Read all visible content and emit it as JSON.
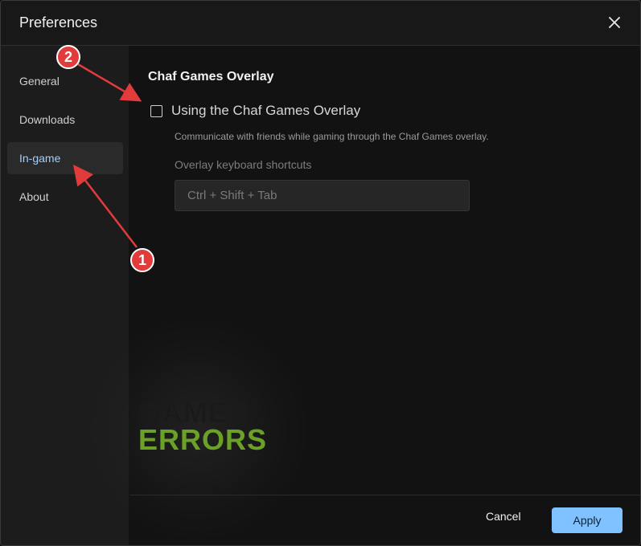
{
  "window": {
    "title": "Preferences"
  },
  "sidebar": {
    "items": [
      {
        "label": "General"
      },
      {
        "label": "Downloads"
      },
      {
        "label": "In-game"
      },
      {
        "label": "About"
      }
    ]
  },
  "main": {
    "section_title": "Chaf Games Overlay",
    "overlay_checkbox_label": "Using the Chaf Games Overlay",
    "overlay_checked": false,
    "description": "Communicate with friends while gaming through the Chaf Games overlay.",
    "shortcut_label": "Overlay keyboard shortcuts",
    "shortcut_value": "Ctrl + Shift + Tab"
  },
  "footer": {
    "cancel_label": "Cancel",
    "apply_label": "Apply"
  },
  "watermark": {
    "line1": "GAMES",
    "line2": "ERRORS"
  },
  "annotations": {
    "badge1": "1",
    "badge2": "2"
  },
  "colors": {
    "accent": "#80c2ff",
    "active_text": "#9fd0ff",
    "badge": "#e23b3b",
    "watermark_green": "#6aa126"
  }
}
